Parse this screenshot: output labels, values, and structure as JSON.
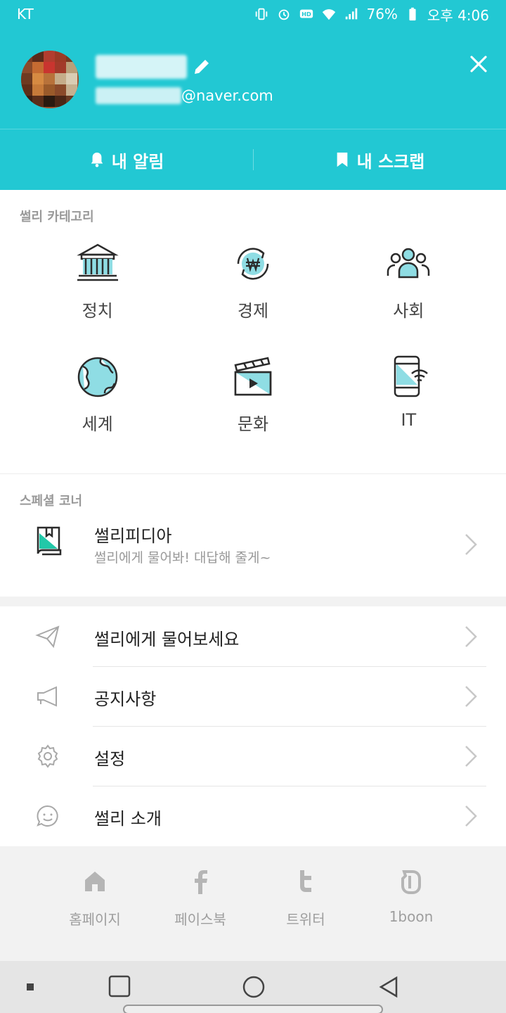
{
  "status_bar": {
    "carrier": "KT",
    "battery": "76%",
    "time": "오후 4:06"
  },
  "header": {
    "email_suffix": "@naver.com",
    "tabs": [
      {
        "label": "내 알림",
        "icon": "bell-icon"
      },
      {
        "label": "내 스크랩",
        "icon": "bookmark-icon"
      }
    ]
  },
  "categories": {
    "section_label": "썰리 카테고리",
    "items": [
      {
        "label": "정치",
        "icon": "bank-building-icon"
      },
      {
        "label": "경제",
        "icon": "won-exchange-icon"
      },
      {
        "label": "사회",
        "icon": "people-group-icon"
      },
      {
        "label": "세계",
        "icon": "globe-icon"
      },
      {
        "label": "문화",
        "icon": "clapperboard-icon"
      },
      {
        "label": "IT",
        "icon": "smartphone-wifi-icon"
      }
    ]
  },
  "special": {
    "section_label": "스페셜 코너",
    "title": "썰리피디아",
    "subtitle": "썰리에게 물어봐! 대답해 줄게~",
    "icon": "book-icon"
  },
  "menu": [
    {
      "label": "썰리에게 물어보세요",
      "icon": "paper-plane-icon"
    },
    {
      "label": "공지사항",
      "icon": "megaphone-icon"
    },
    {
      "label": "설정",
      "icon": "gear-icon"
    },
    {
      "label": "썰리 소개",
      "icon": "smile-bubble-icon"
    }
  ],
  "footer": [
    {
      "label": "홈페이지",
      "icon": "home-icon"
    },
    {
      "label": "페이스북",
      "icon": "facebook-icon"
    },
    {
      "label": "트위터",
      "icon": "twitter-icon"
    },
    {
      "label": "1boon",
      "icon": "1boon-icon"
    }
  ],
  "colors": {
    "accent": "#22c8d3",
    "icon_fill": "#8fdde4",
    "icon_stroke": "#2b2b2b"
  }
}
